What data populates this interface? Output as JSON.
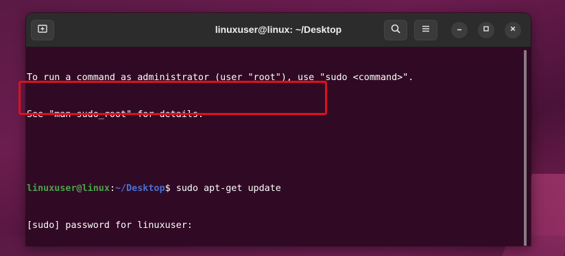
{
  "window": {
    "title": "linuxuser@linux: ~/Desktop"
  },
  "titlebar": {
    "new_tab_icon": "new-tab-icon",
    "search_icon": "search-icon",
    "menu_icon": "hamburger-menu-icon",
    "minimize_icon": "minimize-icon",
    "maximize_icon": "maximize-icon",
    "close_icon": "close-icon"
  },
  "terminal": {
    "line1": "To run a command as administrator (user \"root\"), use \"sudo <command>\".",
    "line2": "See \"man sudo_root\" for details.",
    "prompt_user": "linuxuser@linux",
    "prompt_sep": ":",
    "prompt_path": "~/Desktop",
    "prompt_symbol": "$ ",
    "command": "sudo apt-get update",
    "password_prompt": "[sudo] password for linuxuser:"
  },
  "colors": {
    "terminal_bg": "#300a24",
    "prompt_user": "#4aa34a",
    "prompt_path": "#4a6fd1",
    "highlight_box": "#e0101e"
  }
}
